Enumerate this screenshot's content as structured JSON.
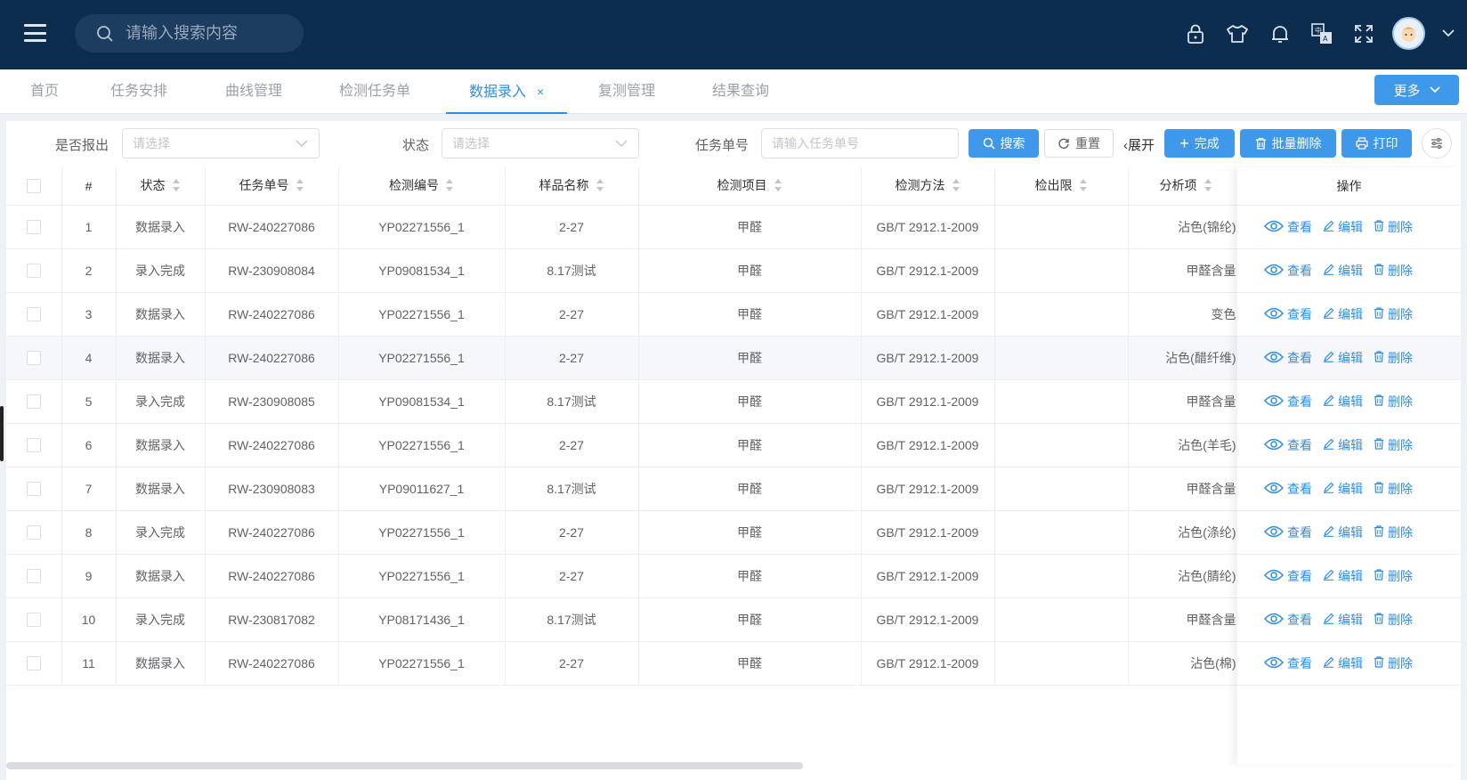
{
  "header": {
    "search_placeholder": "请输入搜索内容",
    "icons": [
      "lock-icon",
      "shirt-icon",
      "bell-icon",
      "translate-icon",
      "fullscreen-icon"
    ]
  },
  "tabs": {
    "items": [
      "首页",
      "任务安排",
      "曲线管理",
      "检测任务单",
      "数据录入",
      "复测管理",
      "结果查询"
    ],
    "active": "数据录入",
    "close_glyph": "×",
    "more_label": "更多"
  },
  "filter": {
    "reported_label": "是否报出",
    "reported_placeholder": "请选择",
    "status_label": "状态",
    "status_placeholder": "请选择",
    "task_label": "任务单号",
    "task_placeholder": "请输入任务单号",
    "search_label": "搜索",
    "reset_label": "重置",
    "expand_label": "展开",
    "complete_label": "完成",
    "batch_delete_label": "批量删除",
    "print_label": "打印"
  },
  "table": {
    "columns": [
      "#",
      "状态",
      "任务单号",
      "检测编号",
      "样品名称",
      "检测项目",
      "检测方法",
      "检出限",
      "分析项"
    ],
    "ops_header": "操作",
    "ops": {
      "view": "查看",
      "edit": "编辑",
      "delete": "删除"
    },
    "highlighted_row": 4,
    "rows": [
      {
        "no": "1",
        "status": "数据录入",
        "task": "RW-240227086",
        "code": "YP02271556_1",
        "sample": "2-27",
        "item": "甲醛",
        "method": "GB/T 2912.1-2009",
        "limit": "",
        "analysis": "沾色(锦纶)"
      },
      {
        "no": "2",
        "status": "录入完成",
        "task": "RW-230908084",
        "code": "YP09081534_1",
        "sample": "8.17测试",
        "item": "甲醛",
        "method": "GB/T 2912.1-2009",
        "limit": "",
        "analysis": "甲醛含量"
      },
      {
        "no": "3",
        "status": "数据录入",
        "task": "RW-240227086",
        "code": "YP02271556_1",
        "sample": "2-27",
        "item": "甲醛",
        "method": "GB/T 2912.1-2009",
        "limit": "",
        "analysis": "变色"
      },
      {
        "no": "4",
        "status": "数据录入",
        "task": "RW-240227086",
        "code": "YP02271556_1",
        "sample": "2-27",
        "item": "甲醛",
        "method": "GB/T 2912.1-2009",
        "limit": "",
        "analysis": "沾色(醋纤维)"
      },
      {
        "no": "5",
        "status": "录入完成",
        "task": "RW-230908085",
        "code": "YP09081534_1",
        "sample": "8.17测试",
        "item": "甲醛",
        "method": "GB/T 2912.1-2009",
        "limit": "",
        "analysis": "甲醛含量"
      },
      {
        "no": "6",
        "status": "数据录入",
        "task": "RW-240227086",
        "code": "YP02271556_1",
        "sample": "2-27",
        "item": "甲醛",
        "method": "GB/T 2912.1-2009",
        "limit": "",
        "analysis": "沾色(羊毛)"
      },
      {
        "no": "7",
        "status": "数据录入",
        "task": "RW-230908083",
        "code": "YP09011627_1",
        "sample": "8.17测试",
        "item": "甲醛",
        "method": "GB/T 2912.1-2009",
        "limit": "",
        "analysis": "甲醛含量"
      },
      {
        "no": "8",
        "status": "录入完成",
        "task": "RW-240227086",
        "code": "YP02271556_1",
        "sample": "2-27",
        "item": "甲醛",
        "method": "GB/T 2912.1-2009",
        "limit": "",
        "analysis": "沾色(涤纶)"
      },
      {
        "no": "9",
        "status": "数据录入",
        "task": "RW-240227086",
        "code": "YP02271556_1",
        "sample": "2-27",
        "item": "甲醛",
        "method": "GB/T 2912.1-2009",
        "limit": "",
        "analysis": "沾色(腈纶)"
      },
      {
        "no": "10",
        "status": "录入完成",
        "task": "RW-230817082",
        "code": "YP08171436_1",
        "sample": "8.17测试",
        "item": "甲醛",
        "method": "GB/T 2912.1-2009",
        "limit": "",
        "analysis": "甲醛含量"
      },
      {
        "no": "11",
        "status": "数据录入",
        "task": "RW-240227086",
        "code": "YP02271556_1",
        "sample": "2-27",
        "item": "甲醛",
        "method": "GB/T 2912.1-2009",
        "limit": "",
        "analysis": "沾色(棉)"
      }
    ]
  },
  "colors": {
    "header_bg": "#0d2d4f",
    "primary": "#4098ea",
    "link": "#2f8de4"
  }
}
